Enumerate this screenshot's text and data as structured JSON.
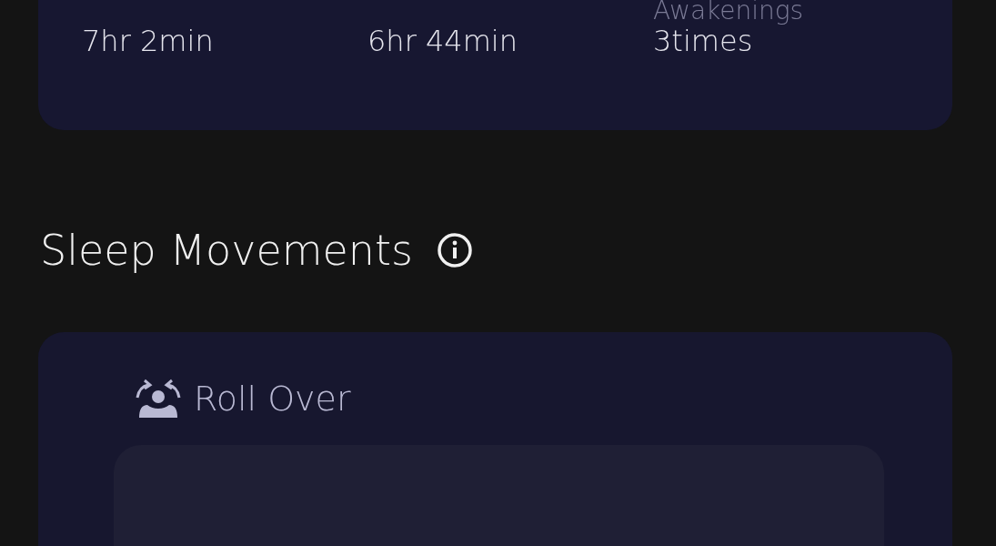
{
  "summary": {
    "stats": [
      {
        "value": "7hr 2min"
      },
      {
        "value": "6hr 44min"
      },
      {
        "label": "Awakenings",
        "value": "3times"
      }
    ]
  },
  "movements": {
    "title": "Sleep Movements",
    "card_title": "Roll Over"
  }
}
